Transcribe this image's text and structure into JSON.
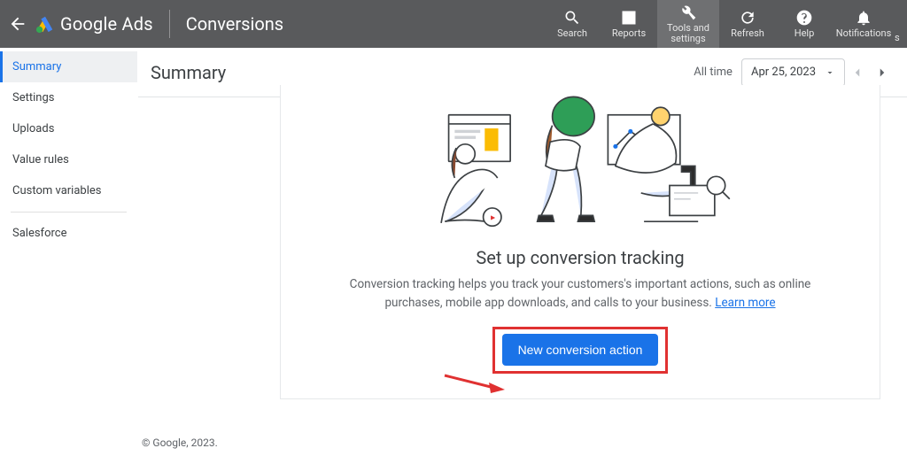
{
  "topbar": {
    "product": "Google Ads",
    "section": "Conversions",
    "actions": {
      "search": "Search",
      "reports": "Reports",
      "tools": "Tools and settings",
      "refresh": "Refresh",
      "help": "Help",
      "notifications": "Notifications"
    }
  },
  "sidenav": {
    "items": [
      {
        "label": "Summary"
      },
      {
        "label": "Settings"
      },
      {
        "label": "Uploads"
      },
      {
        "label": "Value rules"
      },
      {
        "label": "Custom variables"
      },
      {
        "label": "Salesforce"
      }
    ]
  },
  "summary": {
    "title": "Summary",
    "range_label": "All time",
    "date": "Apr 25, 2023"
  },
  "card": {
    "headline": "Set up conversion tracking",
    "subtext": "Conversion tracking helps you track your customers's important actions, such as online purchases, mobile app downloads, and calls to your business. ",
    "learn_more": "Learn more",
    "cta": "New conversion action"
  },
  "footer": {
    "copyright": "© Google, 2023."
  }
}
